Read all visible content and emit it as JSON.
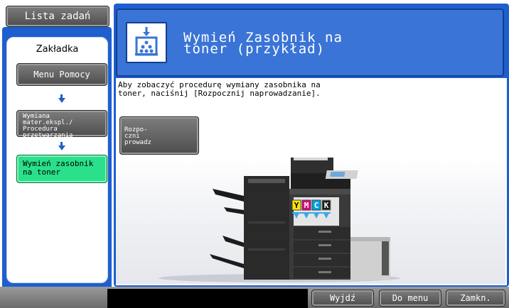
{
  "left": {
    "jobs_button": "Lista zadań",
    "tab_label": "Zakładka",
    "steps": [
      {
        "label": "Menu Pomocy"
      },
      {
        "label": "Wymiana\nmater.ekspl./\nProcedura\nprzetwarzania"
      },
      {
        "label": "Wymień zasobnik\nna toner"
      }
    ]
  },
  "header": {
    "title": "Wymień Zasobnik na\ntoner (przykład)",
    "icon": "toner-box-icon"
  },
  "main": {
    "instruction": "Aby zobaczyć procedurę wymiany zasobnika na\ntoner, naciśnij [Rozpocznij naprowadzanie].",
    "start_button": "Rozpo-\nczni\nprowadz",
    "toner_labels": [
      "Y",
      "M",
      "C",
      "K"
    ]
  },
  "footer": {
    "exit": "Wyjdź",
    "menu": "Do menu",
    "close": "Zamkn."
  },
  "colors": {
    "accent_blue": "#1e5fcf",
    "highlight_green": "#2ae08b",
    "toner_yellow": "#ffe600",
    "toner_magenta": "#e0007a",
    "toner_cyan": "#00a0e0",
    "toner_black": "#1a1a1a"
  }
}
